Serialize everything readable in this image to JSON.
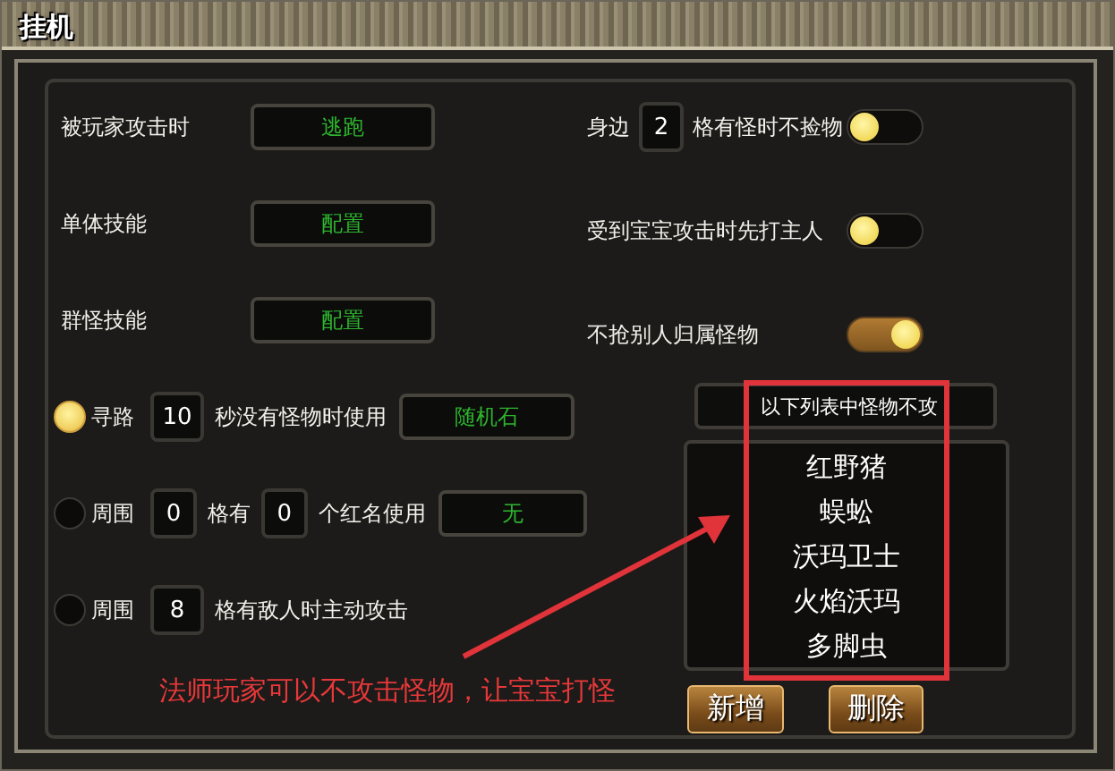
{
  "window": {
    "title": "挂机"
  },
  "left_rows": [
    {
      "kind": "select",
      "parts": [
        {
          "kind": "text",
          "text": "被玩家攻击时"
        },
        {
          "kind": "select",
          "value": "逃跑"
        }
      ]
    },
    {
      "kind": "select",
      "parts": [
        {
          "kind": "text",
          "text": "单体技能"
        },
        {
          "kind": "select",
          "value": "配置"
        }
      ]
    },
    {
      "kind": "select",
      "parts": [
        {
          "kind": "text",
          "text": "群怪技能"
        },
        {
          "kind": "select",
          "value": "配置"
        }
      ]
    },
    {
      "kind": "radio",
      "selected": true,
      "parts": [
        {
          "kind": "text",
          "text": "寻路"
        },
        {
          "kind": "number",
          "value": "10"
        },
        {
          "kind": "text",
          "text": "秒没有怪物时使用"
        },
        {
          "kind": "select",
          "value": "随机石"
        }
      ]
    },
    {
      "kind": "radio",
      "selected": false,
      "parts": [
        {
          "kind": "text",
          "text": "周围"
        },
        {
          "kind": "number",
          "value": "0"
        },
        {
          "kind": "text",
          "text": "格有"
        },
        {
          "kind": "number",
          "value": "0"
        },
        {
          "kind": "text",
          "text": "个红名使用"
        },
        {
          "kind": "select",
          "value": "无"
        }
      ]
    },
    {
      "kind": "radio",
      "selected": false,
      "parts": [
        {
          "kind": "text",
          "text": "周围"
        },
        {
          "kind": "number",
          "value": "8"
        },
        {
          "kind": "text",
          "text": "格有敌人时主动攻击"
        }
      ]
    }
  ],
  "right_rows": [
    {
      "kind": "toggle",
      "on": false,
      "parts": [
        {
          "kind": "text",
          "text": "身边"
        },
        {
          "kind": "number",
          "value": "2"
        },
        {
          "kind": "text",
          "text": "格有怪时不捡物"
        }
      ]
    },
    {
      "kind": "toggle",
      "on": false,
      "parts": [
        {
          "kind": "text",
          "text": "受到宝宝攻击时先打主人"
        }
      ]
    },
    {
      "kind": "toggle",
      "on": true,
      "parts": [
        {
          "kind": "text",
          "text": "不抢别人归属怪物"
        }
      ]
    }
  ],
  "monster_list": {
    "header": "以下列表中怪物不攻",
    "items": [
      "红野猪",
      "蜈蚣",
      "沃玛卫士",
      "火焰沃玛",
      "多脚虫"
    ]
  },
  "buttons": [
    "新增",
    "删除"
  ],
  "annotation": {
    "text": "法师玩家可以不攻击怪物，让宝宝打怪"
  }
}
